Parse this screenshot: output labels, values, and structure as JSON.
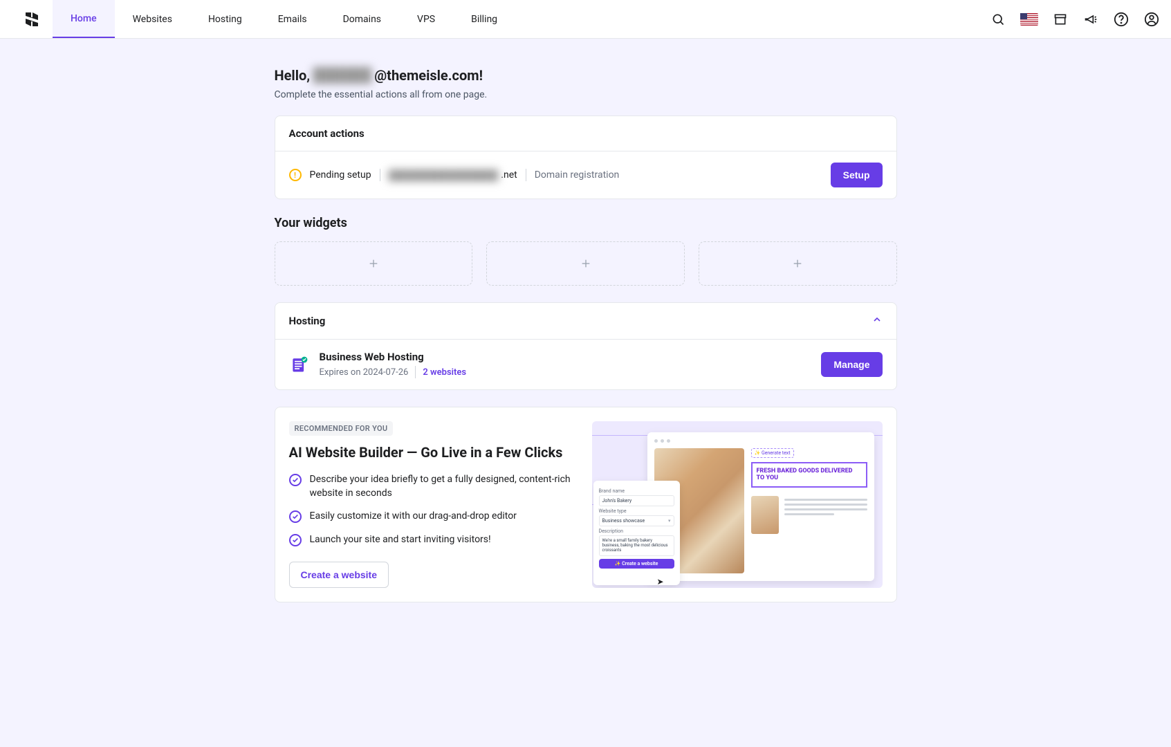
{
  "nav": {
    "items": [
      "Home",
      "Websites",
      "Hosting",
      "Emails",
      "Domains",
      "VPS",
      "Billing"
    ],
    "active": 0
  },
  "greeting": {
    "prefix": "Hello, ",
    "masked_user": "██████",
    "suffix": "@themeisle.com!"
  },
  "subtitle": "Complete the essential actions all from one page.",
  "account": {
    "title": "Account actions",
    "status": "Pending setup",
    "domain_masked": "████████████████",
    "domain_suffix": ".net",
    "action_type": "Domain registration",
    "button": "Setup"
  },
  "widgets": {
    "title": "Your widgets"
  },
  "hosting": {
    "title": "Hosting",
    "plan": "Business Web Hosting",
    "expires": "Expires on 2024-07-26",
    "websites_link": "2 websites",
    "button": "Manage"
  },
  "recommend": {
    "badge": "RECOMMENDED FOR YOU",
    "title": "AI Website Builder — Go Live in a Few Clicks",
    "features": [
      "Describe your idea briefly to get a fully designed, content-rich website in seconds",
      "Easily customize it with our drag-and-drop editor",
      "Launch your site and start inviting visitors!"
    ],
    "button": "Create a website",
    "illustration": {
      "gen_text_btn": "✨ Generate text",
      "headline": "FRESH BAKED GOODS DELIVERED TO YOU",
      "form": {
        "brand_label": "Brand name",
        "brand_value": "John's Bakery",
        "type_label": "Website type",
        "type_value": "Business showcase",
        "desc_label": "Description",
        "desc_value": "We're a small family bakery business, baking the most delicious croissants",
        "create_btn": "✨  Create a website"
      }
    }
  }
}
